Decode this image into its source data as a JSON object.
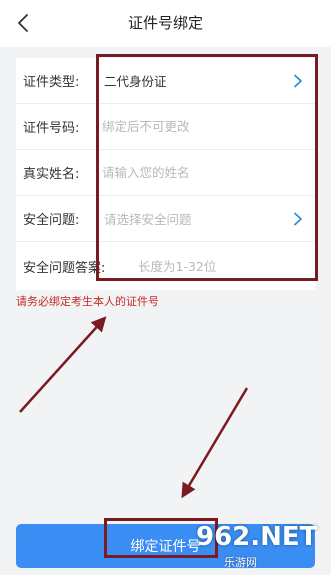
{
  "header": {
    "title": "证件号绑定",
    "back_icon": "chevron-left-icon"
  },
  "form": {
    "rows": [
      {
        "label": "证件类型:",
        "value": "二代身份证",
        "state": "filled",
        "trailing_icon": "chevron-right-icon"
      },
      {
        "label": "证件号码:",
        "placeholder": "绑定后不可更改",
        "state": "placeholder"
      },
      {
        "label": "真实姓名:",
        "placeholder": "请输入您的姓名",
        "state": "placeholder"
      },
      {
        "label": "安全问题:",
        "value": "请选择安全问题",
        "state": "placeholder",
        "trailing_icon": "chevron-right-icon"
      },
      {
        "label": "安全问题答案:",
        "placeholder": "长度为1-32位",
        "state": "placeholder"
      }
    ]
  },
  "note": "请务必绑定考生本人的证件号",
  "submit": {
    "label": "绑定证件号"
  },
  "watermark": {
    "logo": "962.NET",
    "sub": "乐游网"
  },
  "colors": {
    "accent": "#3a8ef3",
    "note": "#c62a2a",
    "annotation": "#7a1a22",
    "chevron": "#2f8fd6"
  }
}
